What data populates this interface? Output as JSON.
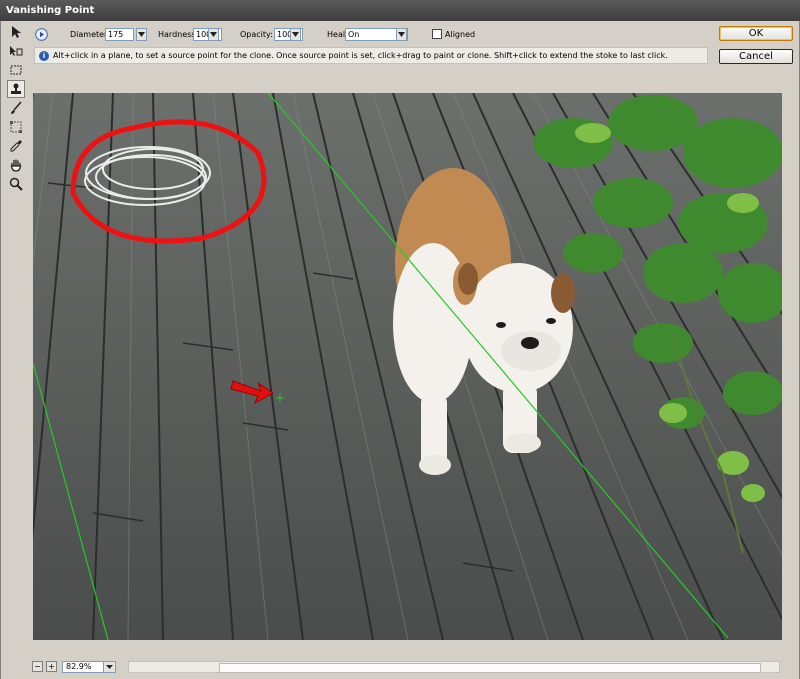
{
  "window": {
    "title": "Vanishing Point"
  },
  "tools": [
    {
      "name": "edit-plane-tool-icon",
      "selected": false
    },
    {
      "name": "create-plane-tool-icon",
      "selected": false
    },
    {
      "name": "marquee-tool-icon",
      "selected": false
    },
    {
      "name": "stamp-tool-icon",
      "selected": true
    },
    {
      "name": "brush-tool-icon",
      "selected": false
    },
    {
      "name": "transform-tool-icon",
      "selected": false
    },
    {
      "name": "eyedropper-tool-icon",
      "selected": false
    },
    {
      "name": "hand-tool-icon",
      "selected": false
    },
    {
      "name": "zoom-tool-icon",
      "selected": false
    }
  ],
  "options": {
    "diameter_label": "Diameter:",
    "diameter_value": "175",
    "hardness_label": "Hardness:",
    "hardness_value": "100",
    "opacity_label": "Opacity:",
    "opacity_value": "100",
    "heal_label": "Heal:",
    "heal_value": "On",
    "aligned_label": "Aligned"
  },
  "buttons": {
    "ok": "OK",
    "cancel": "Cancel"
  },
  "info": {
    "icon": "i",
    "text": "Alt+click in a plane, to set a source point for the clone. Once source point is set, click+drag to paint or clone. Shift+click to extend the stoke to last click."
  },
  "status": {
    "zoom_out": "−",
    "zoom_in": "+",
    "zoom": "82.9%"
  },
  "colors": {
    "plane_grid": "#22cc22",
    "annotation": "#ee1111",
    "ok_border": "#c57c00"
  }
}
